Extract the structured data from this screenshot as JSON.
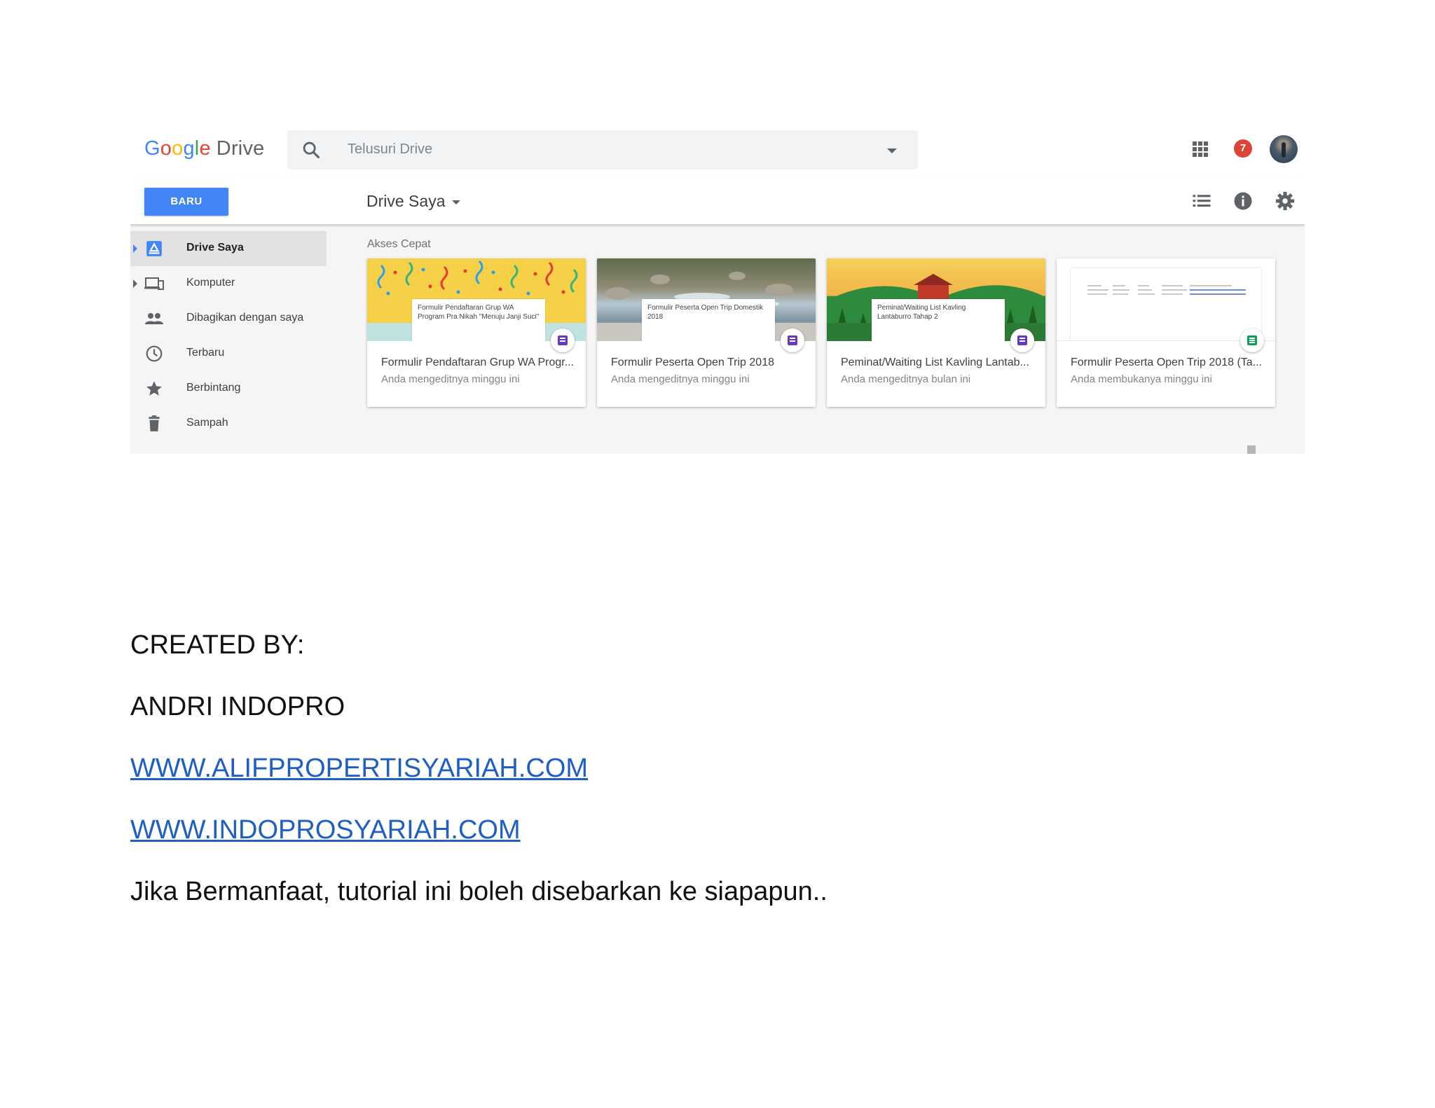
{
  "drive": {
    "logo_word": "Google",
    "logo_product": "Drive",
    "search_placeholder": "Telusuri Drive",
    "notification_count": "7",
    "new_button": "BARU",
    "breadcrumb": "Drive Saya",
    "sidebar": {
      "items": [
        {
          "label": "Drive Saya",
          "icon": "drive-icon",
          "active": true
        },
        {
          "label": "Komputer",
          "icon": "computer-icon",
          "active": false
        },
        {
          "label": "Dibagikan dengan saya",
          "icon": "people-icon",
          "active": false
        },
        {
          "label": "Terbaru",
          "icon": "clock-icon",
          "active": false
        },
        {
          "label": "Berbintang",
          "icon": "star-icon",
          "active": false
        },
        {
          "label": "Sampah",
          "icon": "trash-icon",
          "active": false
        }
      ]
    },
    "quick_access": {
      "title": "Akses Cepat",
      "cards": [
        {
          "thumb_text": "Formulir Pendaftaran Grup WA Program Pra Nikah \"Menuju Janji Suci\"",
          "name": "Formulir Pendaftaran Grup WA Progr...",
          "meta": "Anda mengeditnya minggu ini",
          "type_icon": "forms-icon"
        },
        {
          "thumb_text": "Formulir Peserta Open Trip Domestik 2018",
          "name": "Formulir Peserta Open Trip 2018",
          "meta": "Anda mengeditnya minggu ini",
          "type_icon": "forms-icon"
        },
        {
          "thumb_text": "Peminat/Waiting List Kavling Lantaburro Tahap 2",
          "name": "Peminat/Waiting List Kavling Lantab...",
          "meta": "Anda mengeditnya bulan ini",
          "type_icon": "forms-icon"
        },
        {
          "thumb_text": "",
          "name": "Formulir Peserta Open Trip 2018 (Ta...",
          "meta": "Anda membukanya minggu ini",
          "type_icon": "sheets-icon"
        }
      ]
    },
    "colors": {
      "accent": "#4285f4",
      "notification": "#db4437",
      "forms": "#673ab7",
      "sheets": "#0f9d58"
    }
  },
  "document": {
    "created_by": "CREATED BY:",
    "author": "ANDRI INDOPRO",
    "link_1": "WWW.ALIFPROPERTISYARIAH.COM",
    "link_2": "WWW.INDOPROSYARIAH.COM",
    "note": "Jika Bermanfaat, tutorial ini boleh disebarkan ke siapapun..",
    "link_color": "#1f5ec4"
  }
}
